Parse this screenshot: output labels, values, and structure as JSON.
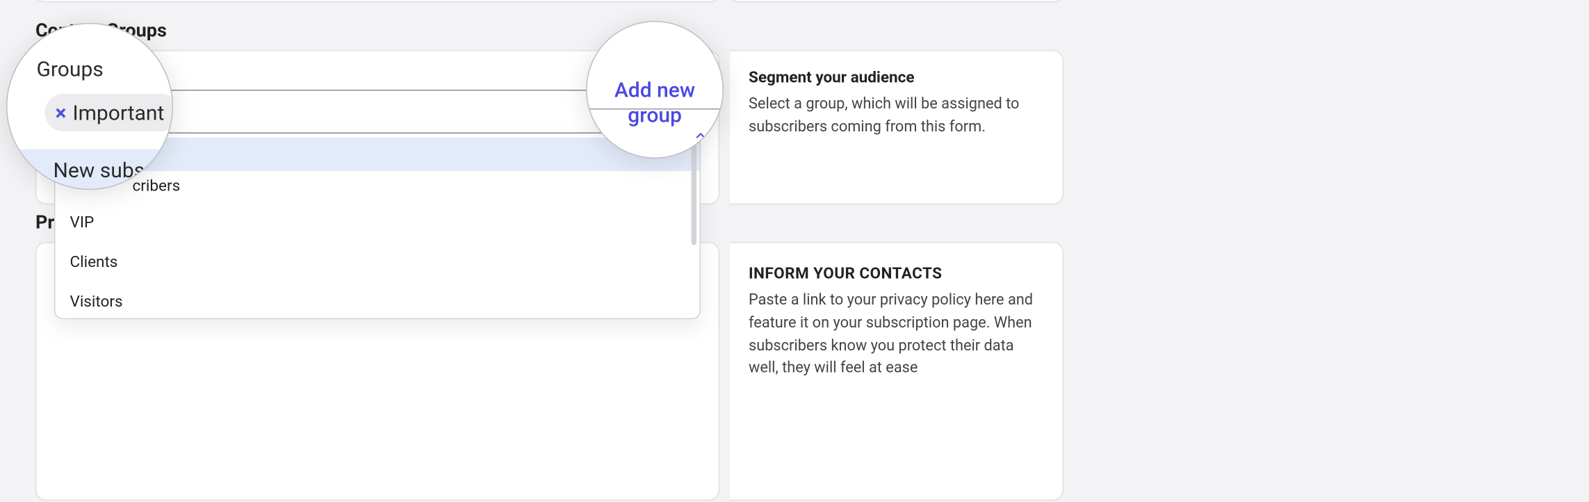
{
  "sections": {
    "contact_groups_title": "Contact Groups",
    "privacy_title_partial": "Pri"
  },
  "help": {
    "segment_title": "Segment your audience",
    "segment_body": "Select a group, which will be assigned to subscribers coming from this form.",
    "inform_title": "INFORM YOUR CONTACTS",
    "inform_body": "Paste a link to your privacy policy here and feature it on your subscription page. When subscribers know you protect their data well, they will feel at ease"
  },
  "bubble_left": {
    "field_label": "Groups",
    "chip_label": "Important",
    "highlight_option": "New subs"
  },
  "bubble_right": {
    "add_link": "Add new group"
  },
  "dropdown": {
    "peek_suffix": "cribers",
    "options": [
      "VIP",
      "Clients",
      "Visitors"
    ]
  }
}
